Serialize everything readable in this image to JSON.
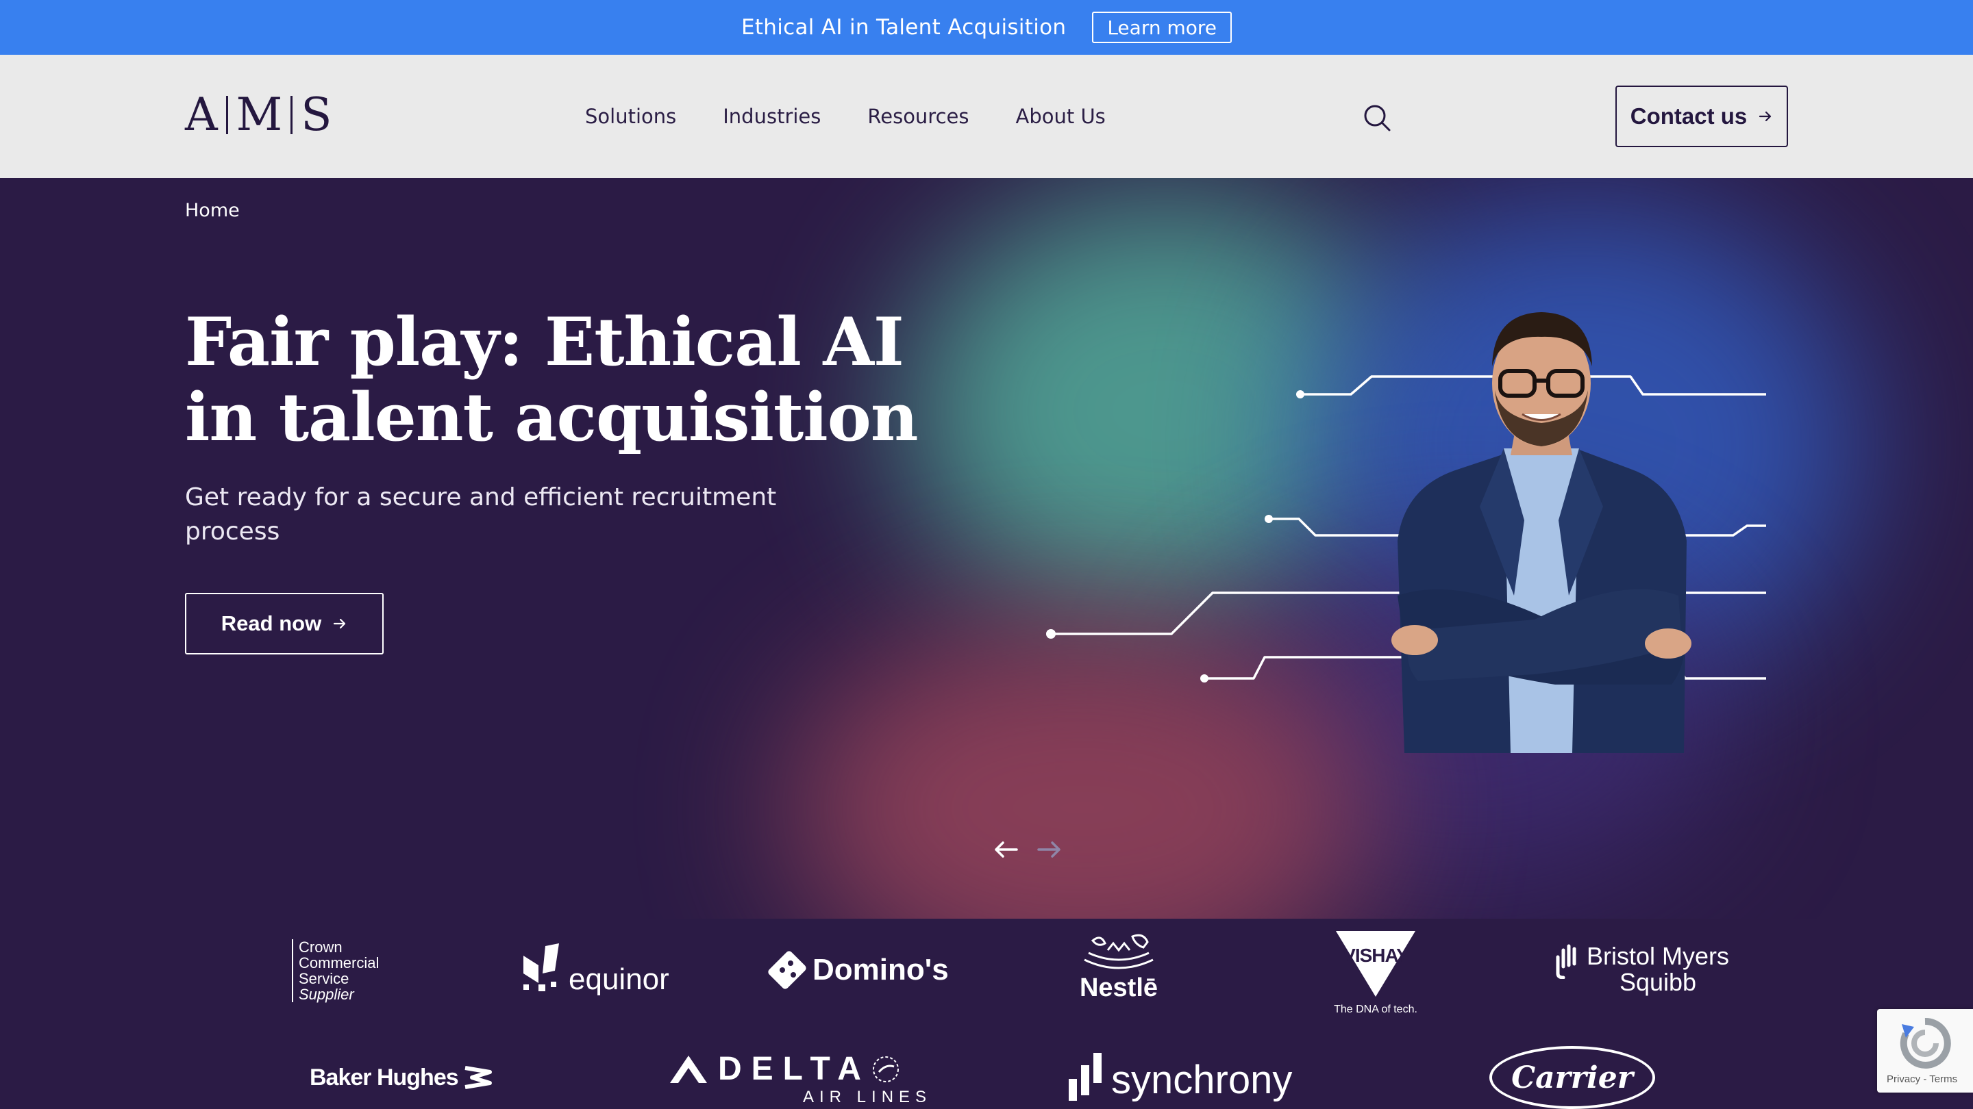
{
  "announcement": {
    "text": "Ethical AI in Talent Acquisition",
    "button_label": "Learn more"
  },
  "header": {
    "logo": [
      "A",
      "M",
      "S"
    ],
    "nav": [
      "Solutions",
      "Industries",
      "Resources",
      "About Us"
    ],
    "search_icon": "search-icon",
    "contact_label": "Contact us"
  },
  "hero": {
    "breadcrumb": "Home",
    "title": "Fair play: Ethical AI in talent acquisition",
    "subtitle": "Get ready for a secure and efficient recruitment process",
    "button_label": "Read now"
  },
  "clients": {
    "crown": [
      "Crown",
      "Commercial",
      "Service",
      "Supplier"
    ],
    "equinor": "equinor",
    "dominos": "Domino's",
    "nestle": "Nestlē",
    "vishay": "VISHAY",
    "vishay_tagline": "The DNA of tech.",
    "bms_1": "Bristol Myers",
    "bms_2": "Squibb",
    "baker": "Baker Hughes",
    "delta": "DELTA",
    "delta_sub": "AIR LINES",
    "synchrony": "synchrony",
    "carrier": "Carrier"
  },
  "recaptcha": {
    "links": "Privacy - Terms"
  },
  "colors": {
    "announcement_bg": "#3880ef",
    "header_bg": "#eaeaea",
    "hero_bg": "#2b1b45",
    "brand_dark": "#24173f"
  }
}
